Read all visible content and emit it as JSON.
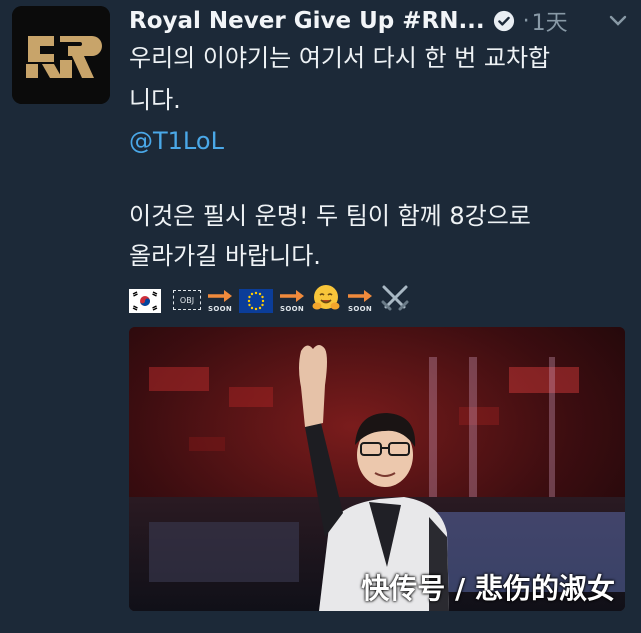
{
  "tweet": {
    "author_name": "Royal Never Give Up #RN...",
    "dot": "·",
    "time": "1天",
    "line1": "우리의 이야기는 여기서 다시 한 번 교차합",
    "line2": "니다.",
    "mention": "@T1LoL",
    "line3": "이것은 필시 운명! 두 팀이 함께 8강으로",
    "line4": "올라가길 바랍니다.",
    "obj_label": "OBJ",
    "soon_label": "SOON"
  },
  "watermark": "快传号 / 悲伤的淑女",
  "colors": {
    "background": "#1c2938",
    "mention": "#4aa8e8",
    "logo_gold": "#c8a46a",
    "muted": "#8899a6"
  },
  "icons": [
    "verified-badge-icon",
    "chevron-down-icon",
    "korea-flag-icon",
    "obj-box-icon",
    "right-arrow-icon",
    "eu-flag-icon",
    "hugging-face-icon",
    "crossed-swords-icon"
  ]
}
